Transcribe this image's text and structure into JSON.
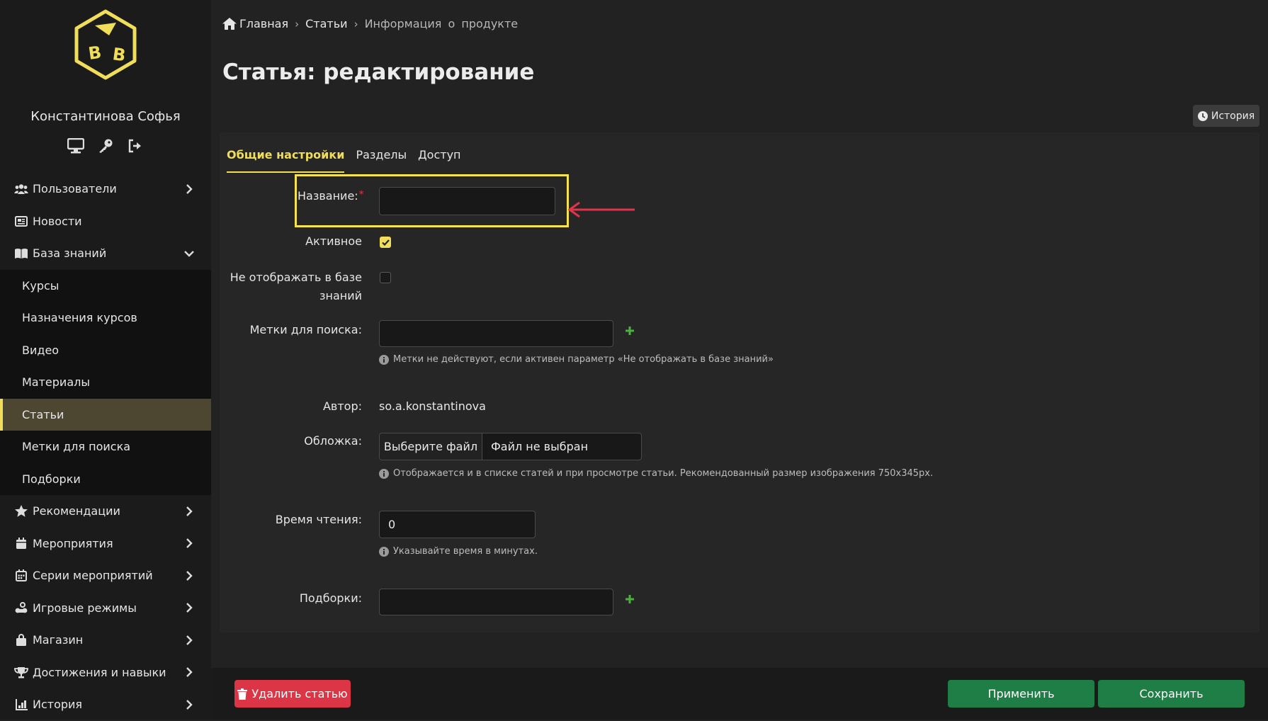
{
  "sidebar": {
    "user_name": "Константинова Софья",
    "user_icons": [
      "monitor-icon",
      "key-icon",
      "logout-icon"
    ],
    "menu": [
      {
        "label": "Пользователи",
        "icon": "users-icon"
      },
      {
        "label": "Новости",
        "icon": "newspaper-icon"
      },
      {
        "label": "База знаний",
        "icon": "book-icon"
      }
    ],
    "submenu": [
      {
        "label": "Курсы"
      },
      {
        "label": "Назначения курсов"
      },
      {
        "label": "Видео"
      },
      {
        "label": "Материалы"
      },
      {
        "label": "Статьи"
      },
      {
        "label": "Метки для поиска"
      },
      {
        "label": "Подборки"
      }
    ],
    "menu_after": [
      {
        "label": "Рекомендации",
        "icon": "star-icon"
      },
      {
        "label": "Мероприятия",
        "icon": "calendar-icon"
      },
      {
        "label": "Серии мероприятий",
        "icon": "calendar-grid-icon"
      },
      {
        "label": "Игровые режимы",
        "icon": "gamepad-icon"
      },
      {
        "label": "Магазин",
        "icon": "shopping-bag-icon"
      },
      {
        "label": "Достижения и навыки",
        "icon": "trophy-icon"
      },
      {
        "label": "История",
        "icon": "chart-icon"
      }
    ]
  },
  "breadcrumb": {
    "home": "Главная",
    "articles": "Статьи",
    "current": "Информация о продукте"
  },
  "page_title": "Статья: редактирование",
  "history_button": "История",
  "tabs": [
    {
      "label": "Общие настройки"
    },
    {
      "label": "Разделы"
    },
    {
      "label": "Доступ"
    }
  ],
  "form": {
    "name_label": "Название:",
    "name_required": "*",
    "name_value": "",
    "active_label": "Активное",
    "active_checked": true,
    "hide_label_line1": "Не отображать в базе",
    "hide_label_line2": "знаний",
    "hide_checked": false,
    "tags_label": "Метки для поиска:",
    "tags_value": "",
    "tags_hint": "Метки не действуют, если активен параметр «Не отображать в базе знаний»",
    "author_label": "Автор:",
    "author_value": "so.a.konstantinova",
    "cover_label": "Обложка:",
    "cover_choose": "Выберите файл",
    "cover_none": "Файл не выбран",
    "cover_hint": "Отображается и в списке статей и при просмотре статьи. Рекомендованный размер изображения 750x345px.",
    "reading_label": "Время чтения:",
    "reading_value": "0",
    "reading_hint": "Указывайте время в минутах.",
    "collections_label": "Подборки:",
    "collections_value": ""
  },
  "footer": {
    "delete": "Удалить статью",
    "apply": "Применить",
    "save": "Сохранить"
  },
  "colors": {
    "accent": "#f0de5a",
    "danger": "#dc3545",
    "success": "#1e7e45",
    "annotation_arrow": "#e0344a"
  }
}
